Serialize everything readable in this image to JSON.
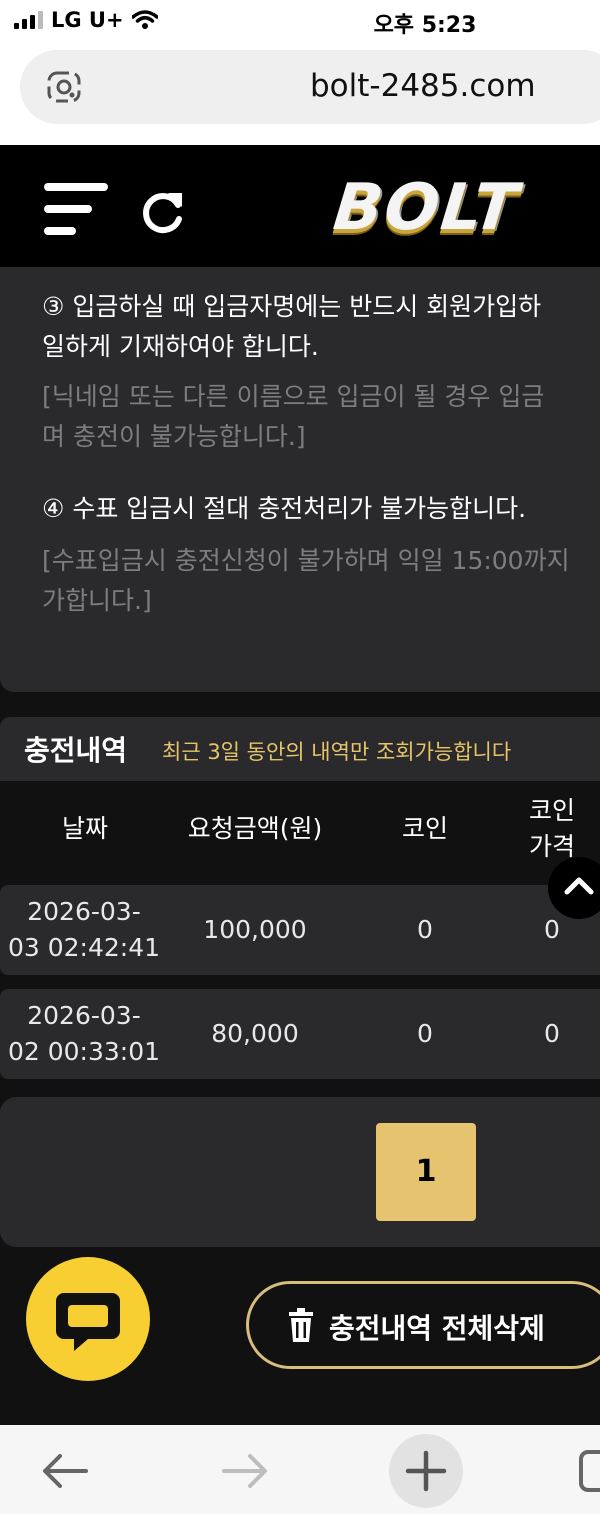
{
  "status_bar": {
    "carrier": "LG U+",
    "time": "오후 5:23"
  },
  "browser": {
    "url": "bolt-2485.com"
  },
  "header": {
    "logo_text": "BOLT"
  },
  "notice": {
    "item3_line1": "③ 입금하실 때 입금자명에는 반드시 회원가입하",
    "item3_line2": "일하게 기재하여야 합니다.",
    "item3_note1": "[닉네임 또는 다른 이름으로 입금이 될 경우 입금",
    "item3_note2": "며 충전이 불가능합니다.]",
    "item4_line1": "④ 수표 입금시 절대 충전처리가 불가능합니다.",
    "item4_note1": "[수표입금시 충전신청이 불가하며 익일 15:00까지",
    "item4_note2": "가합니다.]"
  },
  "history": {
    "title": "충전내역",
    "subtitle": "최근 3일 동안의 내역만 조회가능합니다",
    "columns": {
      "date": "날짜",
      "amount": "요청금액(원)",
      "coin": "코인",
      "coin_price_1": "코인",
      "coin_price_2": "가격"
    },
    "rows": [
      {
        "date_1": "2026-03-",
        "date_2": "03 02:42:41",
        "amount": "100,000",
        "coin": "0",
        "coin_price": "0"
      },
      {
        "date_1": "2026-03-",
        "date_2": "02 00:33:01",
        "amount": "80,000",
        "coin": "0",
        "coin_price": "0"
      }
    ]
  },
  "pagination": {
    "current_page": "1"
  },
  "actions": {
    "delete_all_label": "충전내역 전체삭제"
  },
  "colors": {
    "accent_gold": "#e6c36e",
    "chat_yellow": "#f7cf33",
    "panel_bg": "#2a2a2c",
    "app_bg": "#111112"
  },
  "icons": [
    "signal-icon",
    "wifi-icon",
    "lens-icon",
    "menu-icon",
    "refresh-icon",
    "scroll-top-icon",
    "chat-icon",
    "trash-icon",
    "back-icon",
    "forward-icon",
    "new-tab-icon",
    "tabs-icon"
  ]
}
